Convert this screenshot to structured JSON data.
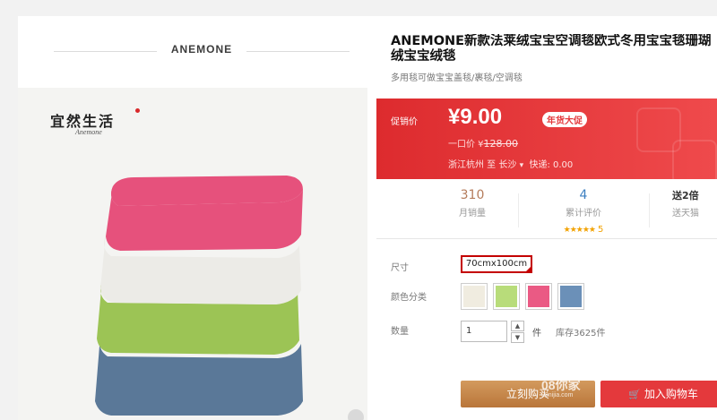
{
  "store": {
    "name": "ANEMONE"
  },
  "image": {
    "brand_cn": "宜然生活",
    "brand_en": "Anemone",
    "towel_colors": [
      "#5a7898",
      "#9cc455",
      "#ecebe7",
      "#e6517c"
    ]
  },
  "product": {
    "title": "ANEMONE新款法莱绒宝宝空调毯欧式冬用宝宝毯珊瑚绒宝宝绒毯",
    "subtitle": "多用毯可做宝宝盖毯/裹毯/空调毯"
  },
  "promo": {
    "label": "促销价",
    "price": "¥9.00",
    "badge": "年货大促",
    "original_label": "一口价 ¥",
    "original_price": "128.00",
    "ship_from": "浙江杭州 至",
    "ship_to": "长沙",
    "ship_chev": "▾",
    "shipping": "快递: 0.00",
    "bg_color": "#e4393c"
  },
  "stats": {
    "monthly_sales": "310",
    "monthly_sales_label": "月销量",
    "reviews": "4",
    "reviews_label": "累计评价",
    "stars": "★★★★★",
    "rating": "5",
    "gift": "送2倍",
    "gift_label": "送天猫"
  },
  "options": {
    "size_label": "尺寸",
    "size_value": "70cmx100cm",
    "color_label": "颜色分类",
    "color_swatches": [
      "#f0ece0",
      "#b8dc7a",
      "#ea5a84",
      "#6b90b8"
    ],
    "qty_label": "数量",
    "qty_value": "1",
    "qty_up": "▲",
    "qty_down": "▼",
    "unit": "件",
    "stock": "库存3625件"
  },
  "actions": {
    "buy_now": "立刻购买",
    "add_to_cart": "加入购物车"
  },
  "watermark": {
    "text": "08你家",
    "sub": "08nijia.com"
  }
}
